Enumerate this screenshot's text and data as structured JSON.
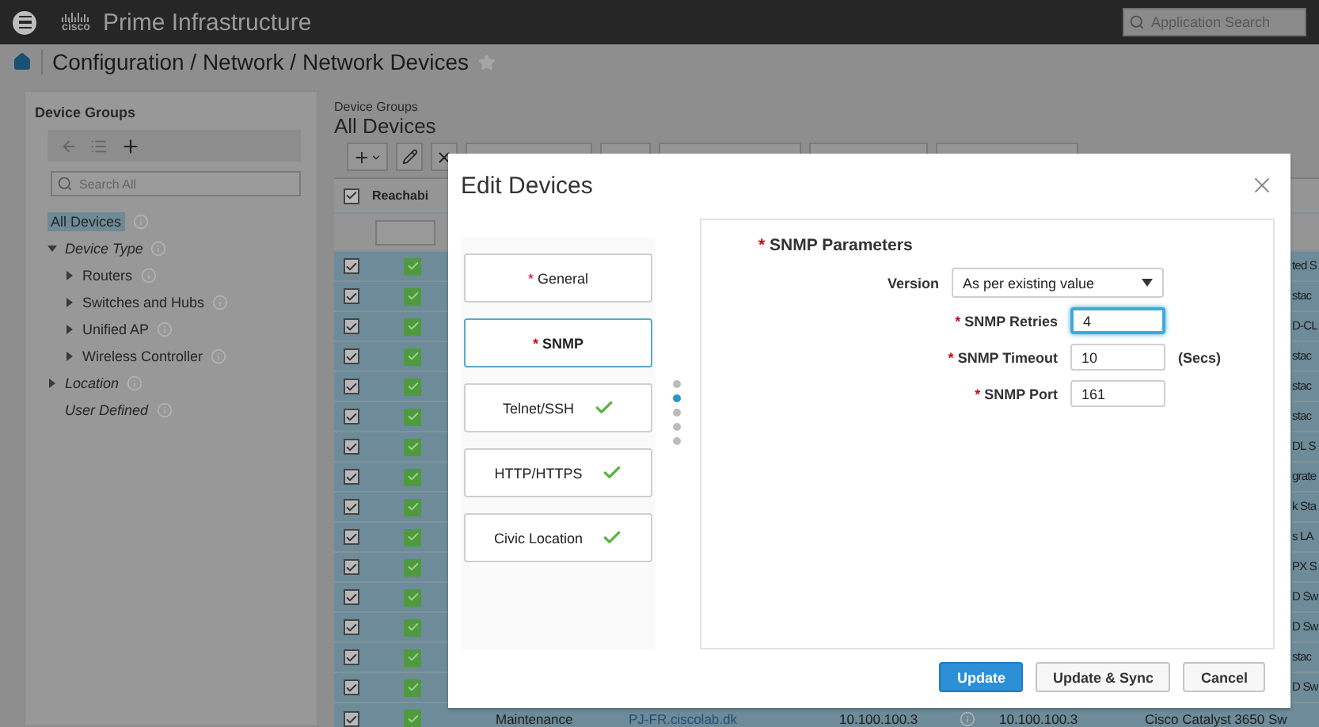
{
  "header": {
    "logo": "cisco",
    "product": "Prime Infrastructure",
    "search": {
      "placeholder": "Application Search"
    }
  },
  "breadcrumb": {
    "path": "Configuration / Network / Network Devices",
    "favorite": false
  },
  "sidebar": {
    "title": "Device Groups",
    "search": {
      "placeholder": "Search All"
    },
    "tree": [
      {
        "label": "All Devices",
        "kind": "root",
        "selected": true
      },
      {
        "label": "Device Type",
        "kind": "category",
        "selected": false,
        "expanded": true,
        "children": [
          {
            "label": "Routers",
            "selected": false,
            "expanded": false
          },
          {
            "label": "Switches and Hubs",
            "selected": false,
            "expanded": false
          },
          {
            "label": "Unified AP",
            "selected": false,
            "expanded": false
          },
          {
            "label": "Wireless Controller",
            "selected": false,
            "expanded": false
          }
        ]
      },
      {
        "label": "Location",
        "kind": "category",
        "selected": false,
        "expanded": false
      },
      {
        "label": "User Defined",
        "kind": "category",
        "selected": false
      }
    ]
  },
  "main": {
    "group_label": "Device Groups",
    "title": "All Devices",
    "toolbar": [
      {
        "kind": "add"
      },
      {
        "kind": "edit"
      },
      {
        "kind": "delete"
      },
      {
        "kind": "menu"
      },
      {
        "kind": "menu"
      },
      {
        "kind": "menu"
      },
      {
        "kind": "menu"
      },
      {
        "kind": "menu"
      }
    ],
    "table": {
      "all_checked": true,
      "columns": [
        {
          "label": "Reachabi"
        }
      ],
      "rows": [
        {
          "checked": true,
          "reachable": true,
          "device_type": "ted S"
        },
        {
          "checked": true,
          "reachable": true,
          "device_type": "stac"
        },
        {
          "checked": true,
          "reachable": true,
          "device_type": "D-CL"
        },
        {
          "checked": true,
          "reachable": true,
          "device_type": "stac"
        },
        {
          "checked": true,
          "reachable": true,
          "device_type": "stac"
        },
        {
          "checked": true,
          "reachable": true,
          "device_type": "stac"
        },
        {
          "checked": true,
          "reachable": true,
          "device_type": "DL S"
        },
        {
          "checked": true,
          "reachable": true,
          "device_type": "grate"
        },
        {
          "checked": true,
          "reachable": true,
          "device_type": "k Sta"
        },
        {
          "checked": true,
          "reachable": true,
          "device_type": "s LA"
        },
        {
          "checked": true,
          "reachable": true,
          "device_type": "PX S"
        },
        {
          "checked": true,
          "reachable": true,
          "device_type": "D Sw"
        },
        {
          "checked": true,
          "reachable": true,
          "device_type": "D Sw"
        },
        {
          "checked": true,
          "reachable": true,
          "device_type": "stac"
        },
        {
          "checked": true,
          "reachable": true,
          "device_type": "D Sw"
        },
        {
          "checked": true,
          "reachable": true,
          "admin_status": "Maintenance",
          "device_name": "PJ-FR.ciscolab.dk",
          "column_5": "10.100.100.3",
          "column_7": "10.100.100.3",
          "device_type": "Cisco Catalyst 3650 Sw"
        }
      ]
    }
  },
  "modal": {
    "title": "Edit Devices",
    "required_mark": "*",
    "nav": [
      {
        "label": "General",
        "required": true,
        "done": false,
        "selected": false
      },
      {
        "label": "SNMP",
        "required": true,
        "done": false,
        "selected": true
      },
      {
        "label": "Telnet/SSH",
        "required": false,
        "done": true,
        "selected": false
      },
      {
        "label": "HTTP/HTTPS",
        "required": false,
        "done": true,
        "selected": false
      },
      {
        "label": "Civic Location",
        "required": false,
        "done": true,
        "selected": false
      }
    ],
    "section": {
      "title": "SNMP Parameters",
      "required": true,
      "fields": [
        {
          "kind": "select",
          "label": "Version",
          "required": false,
          "value": "As per existing value"
        },
        {
          "kind": "text",
          "label": "SNMP Retries",
          "required": true,
          "value": "4",
          "focused": true
        },
        {
          "kind": "text",
          "label": "SNMP Timeout",
          "required": true,
          "value": "10",
          "focused": false,
          "unit": "(Secs)"
        },
        {
          "kind": "text",
          "label": "SNMP Port",
          "required": true,
          "value": "161",
          "focused": false
        }
      ]
    },
    "buttons": [
      {
        "label": "Update",
        "primary": true
      },
      {
        "label": "Update & Sync",
        "primary": false
      },
      {
        "label": "Cancel",
        "primary": false
      }
    ]
  }
}
